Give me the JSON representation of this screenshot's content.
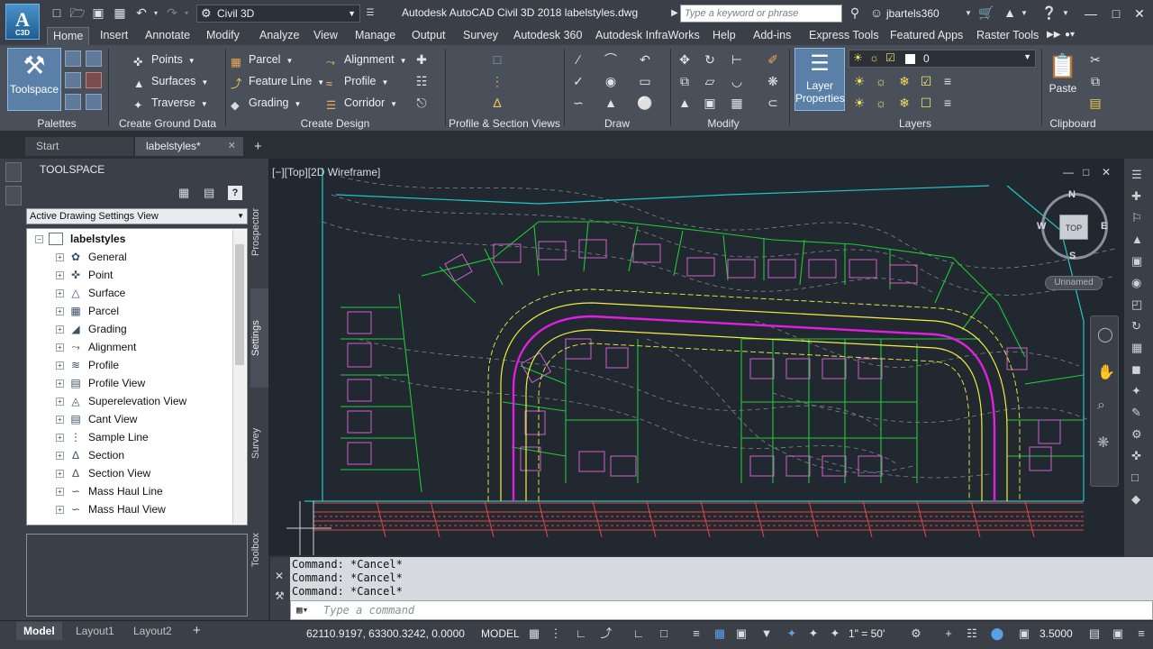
{
  "titlebar": {
    "logo_letter": "A",
    "logo_sub": "C3D",
    "workspace": "Civil 3D",
    "title": "Autodesk AutoCAD Civil 3D 2018    labelstyles.dwg",
    "search_placeholder": "Type a keyword or phrase",
    "user": "jbartels360"
  },
  "ribbon_tabs": [
    "Home",
    "Insert",
    "Annotate",
    "Modify",
    "Analyze",
    "View",
    "Manage",
    "Output",
    "Survey",
    "Autodesk 360",
    "Autodesk InfraWorks",
    "Help",
    "Add-ins",
    "Express Tools",
    "Featured Apps",
    "Raster Tools"
  ],
  "ribbon": {
    "toolspace_label": "Toolspace",
    "ground": [
      "Points",
      "Surfaces",
      "Traverse"
    ],
    "design_left": [
      "Parcel",
      "Feature Line",
      "Grading"
    ],
    "design_right": [
      "Alignment",
      "Profile",
      "Corridor"
    ],
    "layer_props_line1": "Layer",
    "layer_props_line2": "Properties",
    "layer_current": "0",
    "paste_label": "Paste",
    "panels": [
      "Palettes",
      "Create Ground Data",
      "Create Design",
      "Profile & Section Views",
      "Draw",
      "Modify",
      "Layers",
      "Clipboard"
    ]
  },
  "file_tabs": [
    "Start",
    "labelstyles*"
  ],
  "toolspace": {
    "title": "TOOLSPACE",
    "view_mode": "Active Drawing Settings View",
    "root": "labelstyles",
    "items": [
      "General",
      "Point",
      "Surface",
      "Parcel",
      "Grading",
      "Alignment",
      "Profile",
      "Profile View",
      "Superelevation View",
      "Cant View",
      "Sample Line",
      "Section",
      "Section View",
      "Mass Haul Line",
      "Mass Haul View"
    ],
    "vertical_tabs": [
      "Prospector",
      "Settings",
      "Survey",
      "Toolbox"
    ]
  },
  "viewport": {
    "label": "[−][Top][2D Wireframe]",
    "viewcube_top": "TOP",
    "compass": {
      "n": "N",
      "s": "S",
      "e": "E",
      "w": "W"
    },
    "ucs_name": "Unnamed"
  },
  "command_line": {
    "history": [
      "Command: *Cancel*",
      "Command: *Cancel*",
      "Command: *Cancel*"
    ],
    "placeholder": "Type a command"
  },
  "layout_tabs": [
    "Model",
    "Layout1",
    "Layout2"
  ],
  "statusbar": {
    "coords": "62110.9197, 63300.3242, 0.0000",
    "space": "MODEL",
    "scale": "1\" = 50'",
    "annotation_scale": "3.5000"
  },
  "colors": {
    "chrome": "#3b4048",
    "ribbon": "#4a5059",
    "canvas": "#212830",
    "accent": "#5a80a8",
    "road": "#e020e0",
    "lots": "#22c83a",
    "contour": "#8a8f96",
    "labels": "#f0f040",
    "utility": "#e04848"
  }
}
